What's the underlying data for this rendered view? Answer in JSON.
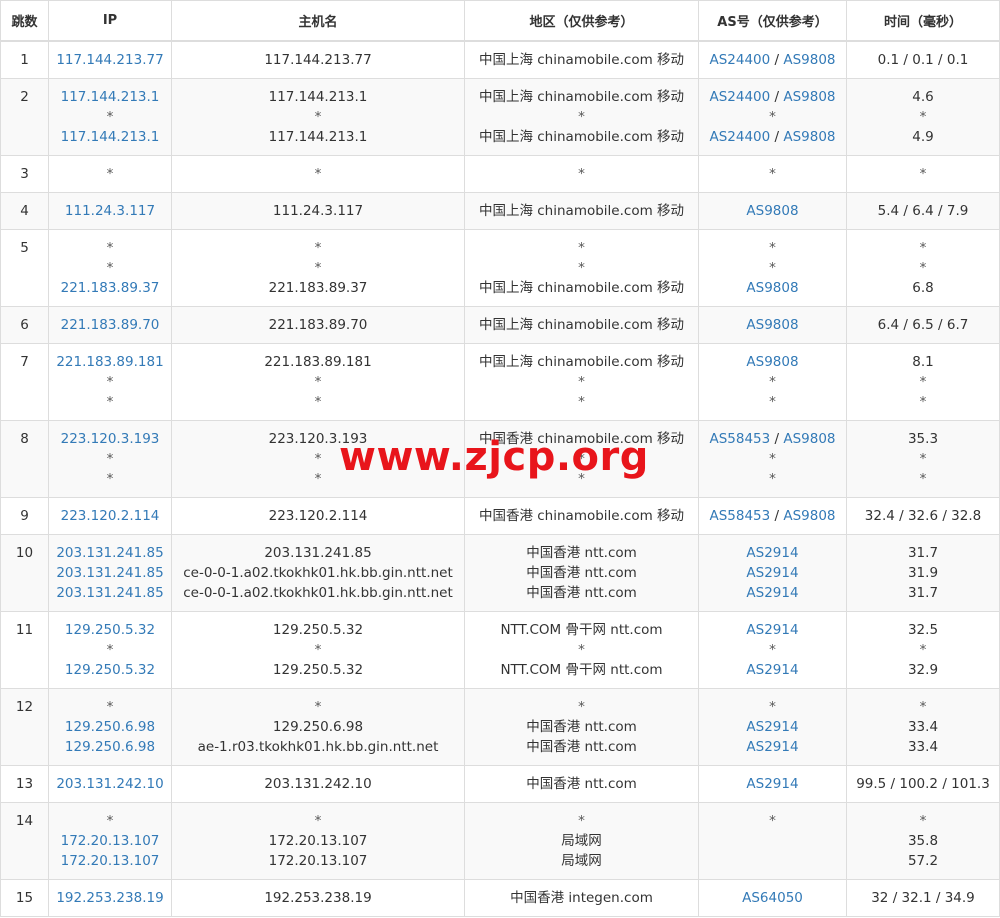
{
  "headers": [
    "跳数",
    "IP",
    "主机名",
    "地区（仅供参考）",
    "AS号（仅供参考）",
    "时间（毫秒）"
  ],
  "watermark": "www.zjcp.org",
  "rows": [
    {
      "hop": "1",
      "ips": [
        "117.144.213.77"
      ],
      "hosts": [
        "117.144.213.77"
      ],
      "regions": [
        "中国上海 chinamobile.com 移动"
      ],
      "as": [
        [
          "AS24400",
          "AS9808"
        ]
      ],
      "times": [
        "0.1 / 0.1 / 0.1"
      ]
    },
    {
      "hop": "2",
      "ips": [
        "117.144.213.1",
        "*",
        "117.144.213.1"
      ],
      "hosts": [
        "117.144.213.1",
        "*",
        "117.144.213.1"
      ],
      "regions": [
        "中国上海 chinamobile.com 移动",
        "*",
        "中国上海 chinamobile.com 移动"
      ],
      "as": [
        [
          "AS24400",
          "AS9808"
        ],
        [
          "*"
        ],
        [
          "AS24400",
          "AS9808"
        ]
      ],
      "times": [
        "4.6",
        "*",
        "4.9"
      ]
    },
    {
      "hop": "3",
      "ips": [
        "*"
      ],
      "hosts": [
        "*"
      ],
      "regions": [
        "*"
      ],
      "as": [
        [
          "*"
        ]
      ],
      "times": [
        "*"
      ]
    },
    {
      "hop": "4",
      "ips": [
        "111.24.3.117"
      ],
      "hosts": [
        "111.24.3.117"
      ],
      "regions": [
        "中国上海 chinamobile.com 移动"
      ],
      "as": [
        [
          "AS9808"
        ]
      ],
      "times": [
        "5.4 / 6.4 / 7.9"
      ]
    },
    {
      "hop": "5",
      "ips": [
        "*",
        "*",
        "221.183.89.37"
      ],
      "hosts": [
        "*",
        "*",
        "221.183.89.37"
      ],
      "regions": [
        "*",
        "*",
        "中国上海 chinamobile.com 移动"
      ],
      "as": [
        [
          "*"
        ],
        [
          "*"
        ],
        [
          "AS9808"
        ]
      ],
      "times": [
        "*",
        "*",
        "6.8"
      ]
    },
    {
      "hop": "6",
      "ips": [
        "221.183.89.70"
      ],
      "hosts": [
        "221.183.89.70"
      ],
      "regions": [
        "中国上海 chinamobile.com 移动"
      ],
      "as": [
        [
          "AS9808"
        ]
      ],
      "times": [
        "6.4 / 6.5 / 6.7"
      ]
    },
    {
      "hop": "7",
      "ips": [
        "221.183.89.181",
        "*",
        "*"
      ],
      "hosts": [
        "221.183.89.181",
        "*",
        "*"
      ],
      "regions": [
        "中国上海 chinamobile.com 移动",
        "*",
        "*"
      ],
      "as": [
        [
          "AS9808"
        ],
        [
          "*"
        ],
        [
          "*"
        ]
      ],
      "times": [
        "8.1",
        "*",
        "*"
      ]
    },
    {
      "hop": "8",
      "ips": [
        "223.120.3.193",
        "*",
        "*"
      ],
      "hosts": [
        "223.120.3.193",
        "*",
        "*"
      ],
      "regions": [
        "中国香港 chinamobile.com 移动",
        "*",
        "*"
      ],
      "as": [
        [
          "AS58453",
          "AS9808"
        ],
        [
          "*"
        ],
        [
          "*"
        ]
      ],
      "times": [
        "35.3",
        "*",
        "*"
      ]
    },
    {
      "hop": "9",
      "ips": [
        "223.120.2.114"
      ],
      "hosts": [
        "223.120.2.114"
      ],
      "regions": [
        "中国香港 chinamobile.com 移动"
      ],
      "as": [
        [
          "AS58453",
          "AS9808"
        ]
      ],
      "times": [
        "32.4 / 32.6 / 32.8"
      ]
    },
    {
      "hop": "10",
      "ips": [
        "203.131.241.85",
        "203.131.241.85",
        "203.131.241.85"
      ],
      "hosts": [
        "203.131.241.85",
        "ce-0-0-1.a02.tkokhk01.hk.bb.gin.ntt.net",
        "ce-0-0-1.a02.tkokhk01.hk.bb.gin.ntt.net"
      ],
      "regions": [
        "中国香港 ntt.com",
        "中国香港 ntt.com",
        "中国香港 ntt.com"
      ],
      "as": [
        [
          "AS2914"
        ],
        [
          "AS2914"
        ],
        [
          "AS2914"
        ]
      ],
      "times": [
        "31.7",
        "31.9",
        "31.7"
      ]
    },
    {
      "hop": "11",
      "ips": [
        "129.250.5.32",
        "*",
        "129.250.5.32"
      ],
      "hosts": [
        "129.250.5.32",
        "*",
        "129.250.5.32"
      ],
      "regions": [
        "NTT.COM 骨干网 ntt.com",
        "*",
        "NTT.COM 骨干网 ntt.com"
      ],
      "as": [
        [
          "AS2914"
        ],
        [
          "*"
        ],
        [
          "AS2914"
        ]
      ],
      "times": [
        "32.5",
        "*",
        "32.9"
      ]
    },
    {
      "hop": "12",
      "ips": [
        "*",
        "129.250.6.98",
        "129.250.6.98"
      ],
      "hosts": [
        "*",
        "129.250.6.98",
        "ae-1.r03.tkokhk01.hk.bb.gin.ntt.net"
      ],
      "regions": [
        "*",
        "中国香港 ntt.com",
        "中国香港 ntt.com"
      ],
      "as": [
        [
          "*"
        ],
        [
          "AS2914"
        ],
        [
          "AS2914"
        ]
      ],
      "times": [
        "*",
        "33.4",
        "33.4"
      ]
    },
    {
      "hop": "13",
      "ips": [
        "203.131.242.10"
      ],
      "hosts": [
        "203.131.242.10"
      ],
      "regions": [
        "中国香港 ntt.com"
      ],
      "as": [
        [
          "AS2914"
        ]
      ],
      "times": [
        "99.5 / 100.2 / 101.3"
      ]
    },
    {
      "hop": "14",
      "ips": [
        "*",
        "172.20.13.107",
        "172.20.13.107"
      ],
      "hosts": [
        "*",
        "172.20.13.107",
        "172.20.13.107"
      ],
      "regions": [
        "*",
        "局域网",
        "局域网"
      ],
      "as": [
        [
          "*"
        ],
        [],
        []
      ],
      "times": [
        "*",
        "35.8",
        "57.2"
      ]
    },
    {
      "hop": "15",
      "ips": [
        "192.253.238.19"
      ],
      "hosts": [
        "192.253.238.19"
      ],
      "regions": [
        "中国香港 integen.com"
      ],
      "as": [
        [
          "AS64050"
        ]
      ],
      "times": [
        "32 / 32.1 / 34.9"
      ]
    }
  ]
}
